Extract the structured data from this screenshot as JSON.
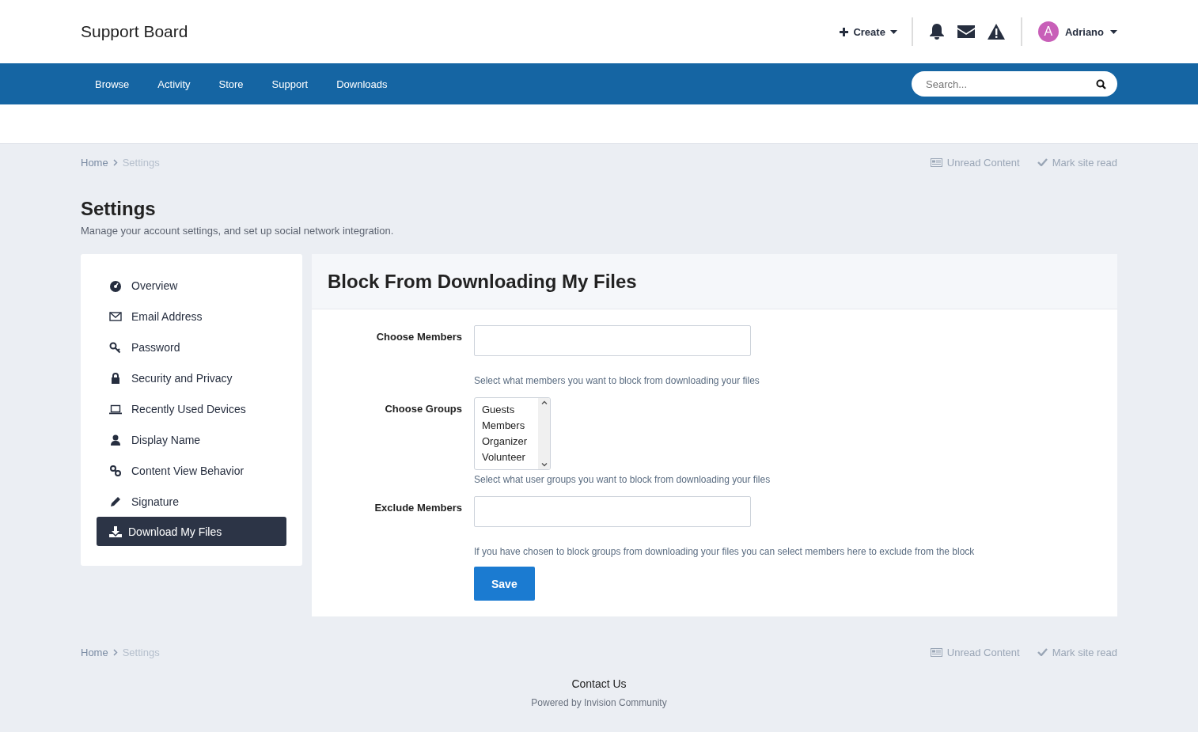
{
  "header": {
    "site_title": "Support Board",
    "create": "Create",
    "user": {
      "initial": "A",
      "name": "Adriano"
    }
  },
  "nav": {
    "items": [
      {
        "label": "Browse"
      },
      {
        "label": "Activity"
      },
      {
        "label": "Store"
      },
      {
        "label": "Support"
      },
      {
        "label": "Downloads"
      }
    ],
    "search": {
      "placeholder": "Search..."
    }
  },
  "breadcrumb": {
    "items": [
      "Home",
      "Settings"
    ],
    "unread": "Unread Content",
    "mark_read": "Mark site read"
  },
  "page": {
    "title": "Settings",
    "subtitle": "Manage your account settings, and set up social network integration."
  },
  "sidebar": {
    "items": [
      {
        "label": "Overview",
        "selected": false
      },
      {
        "label": "Email Address",
        "selected": false
      },
      {
        "label": "Password",
        "selected": false
      },
      {
        "label": "Security and Privacy",
        "selected": false
      },
      {
        "label": "Recently Used Devices",
        "selected": false
      },
      {
        "label": "Display Name",
        "selected": false
      },
      {
        "label": "Content View Behavior",
        "selected": false
      },
      {
        "label": "Signature",
        "selected": false
      },
      {
        "label": "Download My Files",
        "selected": true
      }
    ]
  },
  "form": {
    "title": "Block From Downloading My Files",
    "fields": [
      {
        "kind": "text",
        "label": "Choose Members",
        "help": "Select what members you want to block from downloading your files"
      },
      {
        "kind": "list",
        "label": "Choose Groups",
        "options": [
          "Guests",
          "Members",
          "Organizer",
          "Volunteer"
        ],
        "help": "Select what user groups you want to block from downloading your files"
      },
      {
        "kind": "text",
        "label": "Exclude Members",
        "help": "If you have chosen to block groups from downloading your files you can select members here to exclude from the block"
      }
    ],
    "save": "Save"
  },
  "footer_breadcrumb": {
    "items": [
      "Home",
      "Settings"
    ],
    "unread": "Unread Content",
    "mark_read": "Mark site read"
  },
  "footer": {
    "contact": "Contact Us",
    "powered": "Powered by Invision Community"
  }
}
